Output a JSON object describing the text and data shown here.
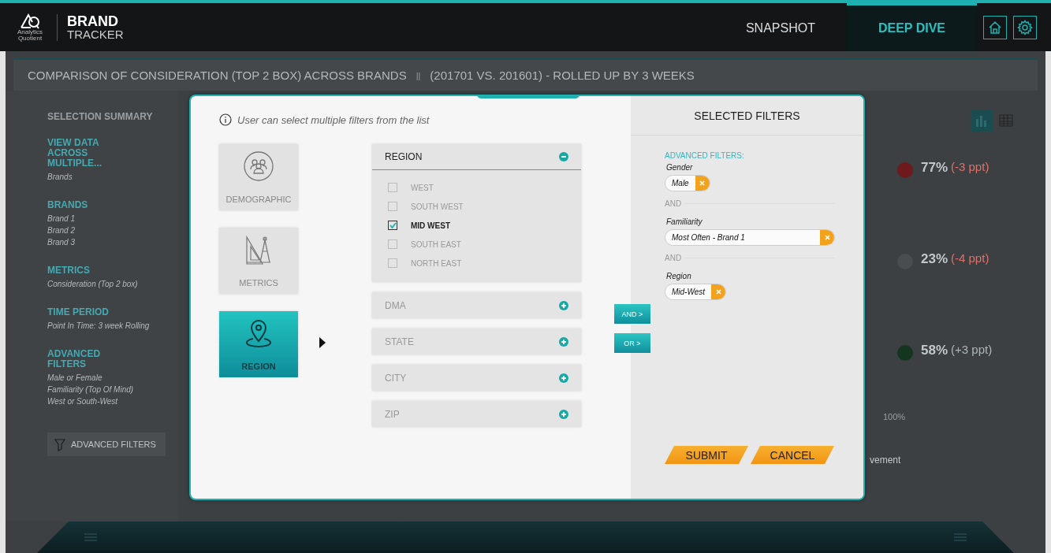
{
  "header": {
    "logo_caption": "Analytics Quotient",
    "title": "BRAND",
    "subtitle": "TRACKER"
  },
  "nav": [
    {
      "label": "SNAPSHOT",
      "selected": false
    },
    {
      "label": "DEEP DIVE",
      "selected": true
    }
  ],
  "page_title": "COMPARISON OF CONSIDERATION (TOP 2 BOX) ACROSS BRANDS",
  "title_separator": "||",
  "page_subtitle": "(201701 VS. 201601) - ROLLED UP BY 3 WEEKS",
  "summary": {
    "title": "SELECTION SUMMARY",
    "sections": [
      {
        "heading": "VIEW DATA ACROSS MULTIPLE...",
        "items": [
          "Brands"
        ]
      },
      {
        "heading": "BRANDS",
        "items": [
          "Brand 1",
          "Brand 2",
          "Brand 3"
        ]
      },
      {
        "heading": "METRICS",
        "items": [
          "Consideration  (Top 2 box)"
        ]
      },
      {
        "heading": "TIME PERIOD",
        "items": [
          "Point In Time: 3 week Rolling"
        ]
      },
      {
        "heading": "ADVANCED FILTERS",
        "items": [
          "Male or Female",
          "Familiarity (Top Of Mind)",
          "West or South-West"
        ]
      }
    ],
    "button": "ADVANCED FILTERS"
  },
  "view_toggle": [
    {
      "kind": "chart",
      "selected": true
    },
    {
      "kind": "table",
      "selected": false
    }
  ],
  "results": [
    {
      "value": "77%",
      "change": "(-3 ppt)",
      "color": "#6e1a1c",
      "negative": true
    },
    {
      "value": "23%",
      "change": "(-4 ppt)",
      "color": "#4a4d50",
      "negative": true
    },
    {
      "value": "58%",
      "change": "(+3 ppt)",
      "color": "#14361f",
      "negative": false
    }
  ],
  "axis_label": "100%",
  "partial_caption": "vement",
  "modal": {
    "hint": "User can select multiple filters from the list",
    "categories": [
      {
        "label": "DEMOGRAPHIC",
        "kind": "people",
        "selected": false
      },
      {
        "label": "METRICS",
        "kind": "ruler",
        "selected": false
      },
      {
        "label": "REGION",
        "kind": "pin",
        "selected": true
      }
    ],
    "groups": [
      {
        "label": "REGION",
        "expanded": true,
        "options": [
          {
            "label": "WEST",
            "checked": false
          },
          {
            "label": "SOUTH WEST",
            "checked": false
          },
          {
            "label": "MID WEST",
            "checked": true
          },
          {
            "label": "SOUTH EAST",
            "checked": false
          },
          {
            "label": "NORTH EAST",
            "checked": false
          }
        ]
      },
      {
        "label": "DMA",
        "expanded": false
      },
      {
        "label": "STATE",
        "expanded": false
      },
      {
        "label": "CITY",
        "expanded": false
      },
      {
        "label": "ZIP",
        "expanded": false
      }
    ],
    "operators": [
      "AND >",
      "OR >"
    ],
    "selected": {
      "title": "SELECTED FILTERS",
      "section": "ADVANCED FILTERS:",
      "filters": [
        {
          "label": "Gender",
          "value": "Male",
          "full_width": false
        },
        {
          "connector": "AND",
          "label": "Familiarity",
          "value": "Most Often - Brand 1",
          "full_width": true
        },
        {
          "connector": "AND",
          "label": "Region",
          "value": "Mid-West",
          "full_width": false
        }
      ],
      "buttons": [
        "SUBMIT",
        "CANCEL"
      ]
    }
  }
}
